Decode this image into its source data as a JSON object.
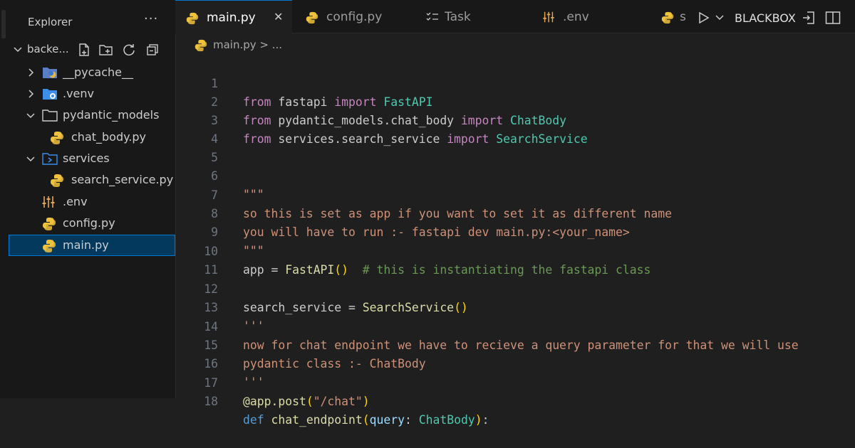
{
  "explorer": {
    "title": "Explorer",
    "more": "···",
    "folder": "backe...",
    "items": [
      {
        "label": "__pycache__"
      },
      {
        "label": ".venv"
      },
      {
        "label": "pydantic_models"
      },
      {
        "label": "chat_body.py"
      },
      {
        "label": "services"
      },
      {
        "label": "search_service.py"
      },
      {
        "label": ".env"
      },
      {
        "label": "config.py"
      },
      {
        "label": "main.py"
      }
    ]
  },
  "tabs": [
    {
      "label": "main.py",
      "close": "✕"
    },
    {
      "label": "config.py"
    },
    {
      "label": "Task"
    },
    {
      "label": ".env"
    },
    {
      "label": "s"
    }
  ],
  "run": {
    "label": "BLACKBOX"
  },
  "breadcrumb": {
    "text": "main.py > ..."
  },
  "code": {
    "lines": [
      {
        "n": "1"
      },
      {
        "n": "2"
      },
      {
        "n": "3"
      },
      {
        "n": "4"
      },
      {
        "n": "5"
      },
      {
        "n": "6"
      },
      {
        "n": "7"
      },
      {
        "n": "8"
      },
      {
        "n": "9"
      },
      {
        "n": "10"
      },
      {
        "n": "11"
      },
      {
        "n": "12"
      },
      {
        "n": "13"
      },
      {
        "n": "14"
      },
      {
        "n": "15"
      },
      {
        "n": "16"
      },
      {
        "n": "17"
      },
      {
        "n": "18"
      }
    ],
    "t": {
      "from": "from",
      "import": "import",
      "l1_mod": " fastapi ",
      "l1_cls": "FastAPI",
      "l2_mod": " pydantic_models.chat_body ",
      "l2_cls": "ChatBody",
      "l3_mod": " services.search_service ",
      "l3_cls": "SearchService",
      "l6": "\"\"\"",
      "l7": "so this is set as app if you want to set it as different name",
      "l8": "you will have to run :- fastapi dev main.py:<your_name>",
      "l9": "\"\"\"",
      "l10_a": "app = ",
      "l10_fn": "FastAPI",
      "l10_br": "()",
      "l10_cm": "  # this is instantiating the fastapi class",
      "l12_a": "search_service = ",
      "l12_fn": "SearchService",
      "l12_br": "()",
      "l13": "'''",
      "l14": "now for chat endpoint we have to recieve a query parameter for that we will use",
      "l15": "pydantic class :- ChatBody",
      "l16": "'''",
      "l17_a": "@app.post",
      "l17_b": "(",
      "l17_s": "\"/chat\"",
      "l17_c": ")",
      "l18_def": "def",
      "l18_fn": " chat_endpoint",
      "l18_b": "(",
      "l18_p": "query",
      "l18_c": ": ",
      "l18_t": "ChatBody",
      "l18_e": ")",
      "l18_colon": ":"
    }
  },
  "colors": {
    "accent": "#0078d4",
    "selected_bg": "#04395e",
    "editor_bg": "#1f1f1f",
    "sidebar_bg": "#181818"
  }
}
